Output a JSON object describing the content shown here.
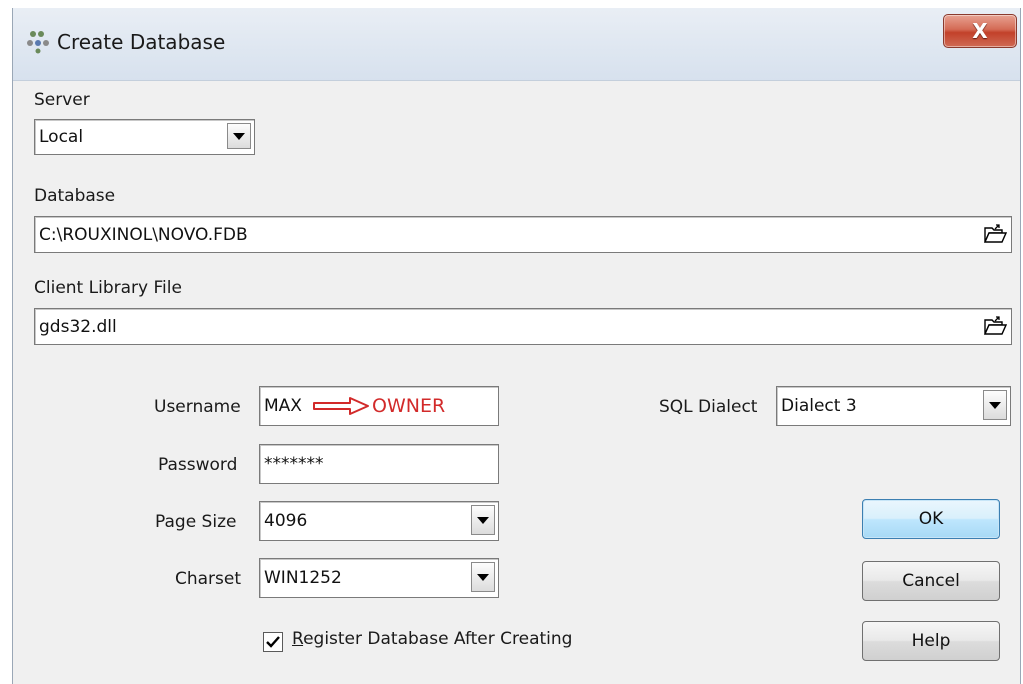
{
  "window": {
    "title": "Create Database",
    "close_label": "X"
  },
  "server": {
    "label": "Server",
    "value": "Local"
  },
  "database": {
    "label": "Database",
    "value": "C:\\ROUXINOL\\NOVO.FDB"
  },
  "client_library": {
    "label": "Client Library File",
    "value": "gds32.dll"
  },
  "username": {
    "label": "Username",
    "value": "MAX",
    "annotation": "OWNER"
  },
  "password": {
    "label": "Password",
    "value": "*******"
  },
  "page_size": {
    "label": "Page Size",
    "value": "4096"
  },
  "charset": {
    "label": "Charset",
    "value": "WIN1252"
  },
  "sql_dialect": {
    "label": "SQL Dialect",
    "value": "Dialect 3"
  },
  "register": {
    "first_letter": "R",
    "rest": "egister Database After Creating",
    "checked": true
  },
  "buttons": {
    "ok": "OK",
    "cancel": "Cancel",
    "help": "Help"
  },
  "colors": {
    "annotation": "#d22a2a",
    "close": "#c2412a",
    "default_button": "#bee6fd"
  }
}
